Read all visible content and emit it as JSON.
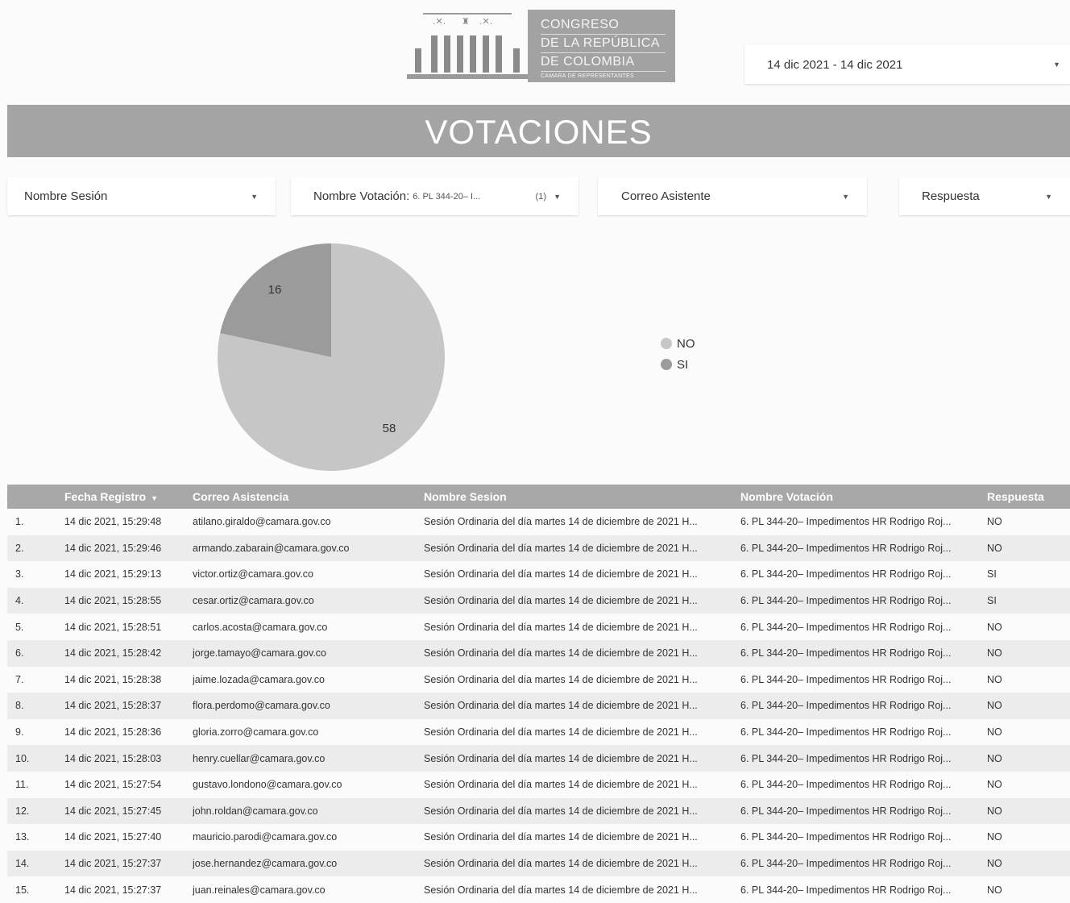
{
  "logo": {
    "line1": "CONGRESO",
    "line2": "DE LA REPÚBLICA",
    "line3": "DE COLOMBIA",
    "line4": "CAMARA DE REPRESENTANTES"
  },
  "date_range": {
    "value": "14 dic 2021 - 14 dic 2021",
    "icon": "caret-down-icon"
  },
  "title": "VOTACIONES",
  "filters": {
    "sesion": {
      "label": "Nombre Sesión"
    },
    "votacion": {
      "label": "Nombre Votación:",
      "selected": "6. PL 344-20– I...",
      "count": "(1)"
    },
    "correo": {
      "label": "Correo Asistente"
    },
    "respuesta": {
      "label": "Respuesta"
    }
  },
  "chart_data": {
    "type": "pie",
    "slices": [
      {
        "label": "NO",
        "value": 58,
        "color": "#c6c6c6"
      },
      {
        "label": "SI",
        "value": 16,
        "color": "#9b9b9b"
      }
    ],
    "legend": [
      "NO",
      "SI"
    ],
    "legend_position": "right",
    "title": ""
  },
  "table": {
    "headers": {
      "fecha": "Fecha Registro",
      "correo": "Correo Asistencia",
      "sesion": "Nombre Sesion",
      "votacion": "Nombre Votación",
      "respuesta": "Respuesta"
    },
    "rows": [
      {
        "n": "1.",
        "fecha": "14 dic 2021, 15:29:48",
        "correo": "atilano.giraldo@camara.gov.co",
        "sesion": "Sesión Ordinaria del día martes 14 de diciembre de 2021 H...",
        "votacion": "6. PL 344-20– Impedimentos HR Rodrigo Roj...",
        "respuesta": "NO"
      },
      {
        "n": "2.",
        "fecha": "14 dic 2021, 15:29:46",
        "correo": "armando.zabarain@camara.gov.co",
        "sesion": "Sesión Ordinaria del día martes 14 de diciembre de 2021 H...",
        "votacion": "6. PL 344-20– Impedimentos HR Rodrigo Roj...",
        "respuesta": "NO"
      },
      {
        "n": "3.",
        "fecha": "14 dic 2021, 15:29:13",
        "correo": "victor.ortiz@camara.gov.co",
        "sesion": "Sesión Ordinaria del día martes 14 de diciembre de 2021 H...",
        "votacion": "6. PL 344-20– Impedimentos HR Rodrigo Roj...",
        "respuesta": "SI"
      },
      {
        "n": "4.",
        "fecha": "14 dic 2021, 15:28:55",
        "correo": "cesar.ortiz@camara.gov.co",
        "sesion": "Sesión Ordinaria del día martes 14 de diciembre de 2021 H...",
        "votacion": "6. PL 344-20– Impedimentos HR Rodrigo Roj...",
        "respuesta": "SI"
      },
      {
        "n": "5.",
        "fecha": "14 dic 2021, 15:28:51",
        "correo": "carlos.acosta@camara.gov.co",
        "sesion": "Sesión Ordinaria del día martes 14 de diciembre de 2021 H...",
        "votacion": "6. PL 344-20– Impedimentos HR Rodrigo Roj...",
        "respuesta": "NO"
      },
      {
        "n": "6.",
        "fecha": "14 dic 2021, 15:28:42",
        "correo": "jorge.tamayo@camara.gov.co",
        "sesion": "Sesión Ordinaria del día martes 14 de diciembre de 2021 H...",
        "votacion": "6. PL 344-20– Impedimentos HR Rodrigo Roj...",
        "respuesta": "NO"
      },
      {
        "n": "7.",
        "fecha": "14 dic 2021, 15:28:38",
        "correo": "jaime.lozada@camara.gov.co",
        "sesion": "Sesión Ordinaria del día martes 14 de diciembre de 2021 H...",
        "votacion": "6. PL 344-20– Impedimentos HR Rodrigo Roj...",
        "respuesta": "NO"
      },
      {
        "n": "8.",
        "fecha": "14 dic 2021, 15:28:37",
        "correo": "flora.perdomo@camara.gov.co",
        "sesion": "Sesión Ordinaria del día martes 14 de diciembre de 2021 H...",
        "votacion": "6. PL 344-20– Impedimentos HR Rodrigo Roj...",
        "respuesta": "NO"
      },
      {
        "n": "9.",
        "fecha": "14 dic 2021, 15:28:36",
        "correo": "gloria.zorro@camara.gov.co",
        "sesion": "Sesión Ordinaria del día martes 14 de diciembre de 2021 H...",
        "votacion": "6. PL 344-20– Impedimentos HR Rodrigo Roj...",
        "respuesta": "NO"
      },
      {
        "n": "10.",
        "fecha": "14 dic 2021, 15:28:03",
        "correo": "henry.cuellar@camara.gov.co",
        "sesion": "Sesión Ordinaria del día martes 14 de diciembre de 2021 H...",
        "votacion": "6. PL 344-20– Impedimentos HR Rodrigo Roj...",
        "respuesta": "NO"
      },
      {
        "n": "11.",
        "fecha": "14 dic 2021, 15:27:54",
        "correo": "gustavo.londono@camara.gov.co",
        "sesion": "Sesión Ordinaria del día martes 14 de diciembre de 2021 H...",
        "votacion": "6. PL 344-20– Impedimentos HR Rodrigo Roj...",
        "respuesta": "NO"
      },
      {
        "n": "12.",
        "fecha": "14 dic 2021, 15:27:45",
        "correo": "john.roldan@camara.gov.co",
        "sesion": "Sesión Ordinaria del día martes 14 de diciembre de 2021 H...",
        "votacion": "6. PL 344-20– Impedimentos HR Rodrigo Roj...",
        "respuesta": "NO"
      },
      {
        "n": "13.",
        "fecha": "14 dic 2021, 15:27:40",
        "correo": "mauricio.parodi@camara.gov.co",
        "sesion": "Sesión Ordinaria del día martes 14 de diciembre de 2021 H...",
        "votacion": "6. PL 344-20– Impedimentos HR Rodrigo Roj...",
        "respuesta": "NO"
      },
      {
        "n": "14.",
        "fecha": "14 dic 2021, 15:27:37",
        "correo": "jose.hernandez@camara.gov.co",
        "sesion": "Sesión Ordinaria del día martes 14 de diciembre de 2021 H...",
        "votacion": "6. PL 344-20– Impedimentos HR Rodrigo Roj...",
        "respuesta": "NO"
      },
      {
        "n": "15.",
        "fecha": "14 dic 2021, 15:27:37",
        "correo": "juan.reinales@camara.gov.co",
        "sesion": "Sesión Ordinaria del día martes 14 de diciembre de 2021 H...",
        "votacion": "6. PL 344-20– Impedimentos HR Rodrigo Roj...",
        "respuesta": "NO"
      }
    ]
  }
}
